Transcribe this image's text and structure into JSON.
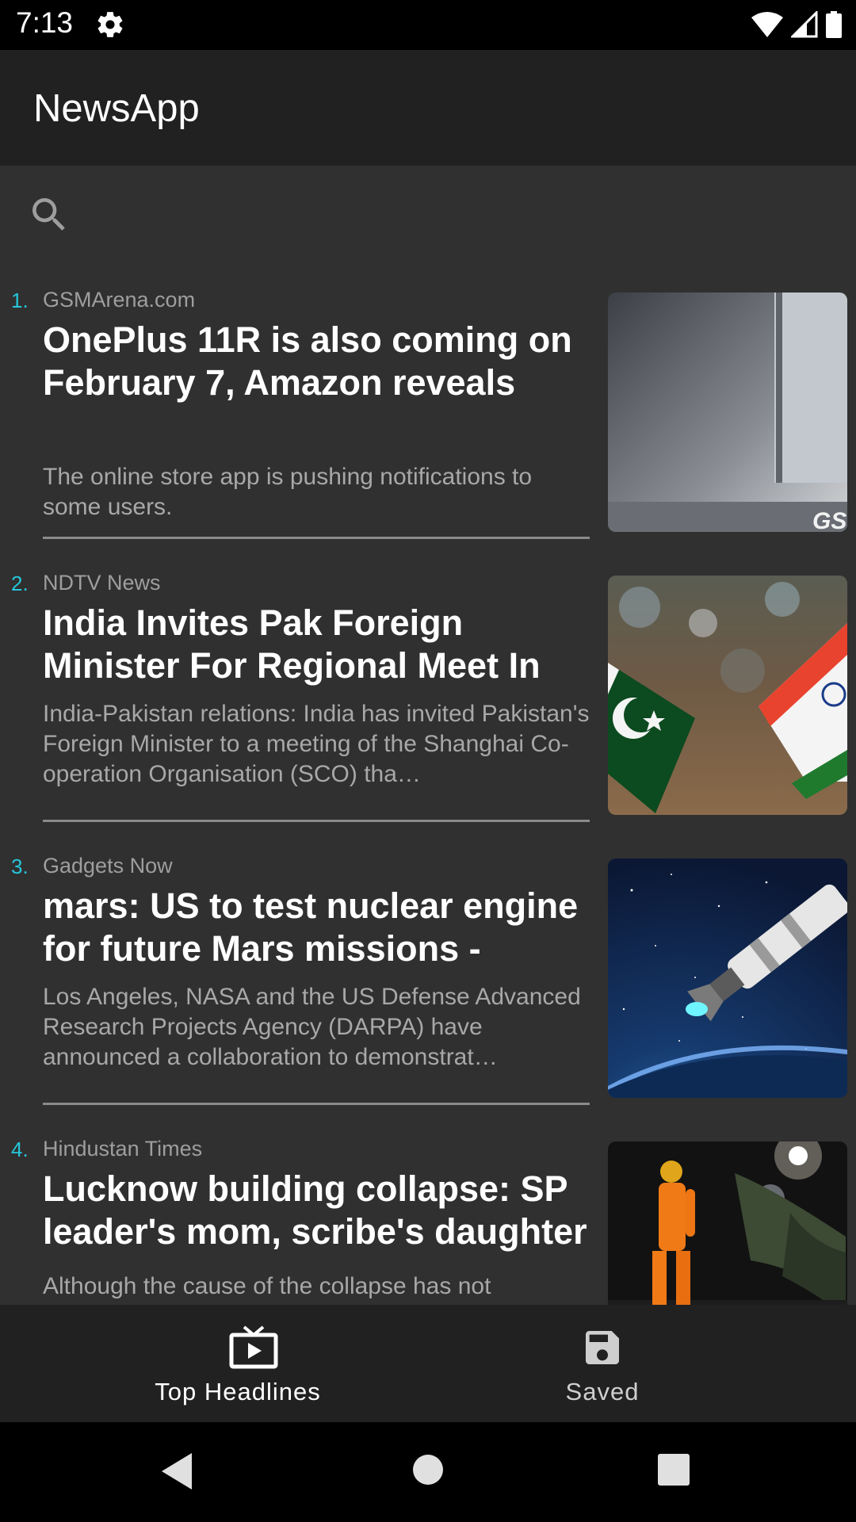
{
  "status_bar": {
    "time": "7:13",
    "icons": [
      "gear-icon",
      "wifi-icon",
      "signal-icon",
      "battery-icon"
    ]
  },
  "app_bar": {
    "title": "NewsApp"
  },
  "search": {
    "icon": "search-icon",
    "value": ""
  },
  "colors": {
    "background": "#303030",
    "app_bar": "#212121",
    "accent_number": "#26c6da",
    "source_text": "#9e9e9e",
    "description_text": "#a8a8a8",
    "divider": "#8a8a8a"
  },
  "articles": [
    {
      "number": "1.",
      "source": "GSMArena.com",
      "title": "OnePlus 11R is also coming on February 7, Amazon reveals",
      "description": "The online store app is pushing notifications to some users.",
      "thumbnail_text": "GSI"
    },
    {
      "number": "2.",
      "source": "NDTV News",
      "title": "India Invites Pak Foreign Minister For Regional Meet In",
      "description": "India-Pakistan relations: India has invited Pakistan's Foreign Minister to a meeting of the Shanghai Co-operation Organisation (SCO) tha…"
    },
    {
      "number": "3.",
      "source": "Gadgets Now",
      "title": "mars: US to test nuclear engine for future Mars missions -",
      "description": "Los Angeles, NASA and the US Defense Advanced Research Projects Agency (DARPA) have announced a collaboration to demonstrat…"
    },
    {
      "number": "4.",
      "source": "Hindustan Times",
      "title": "Lucknow building collapse: SP leader's mom, scribe's daughter",
      "description": "Although the cause of the collapse has not"
    }
  ],
  "bottom_nav": {
    "items": [
      {
        "label": "Top Headlines",
        "icon": "tv-icon",
        "selected": true
      },
      {
        "label": "Saved",
        "icon": "save-icon",
        "selected": false
      }
    ]
  },
  "system_nav": {
    "icons": [
      "back-icon",
      "home-icon",
      "recents-icon"
    ]
  }
}
